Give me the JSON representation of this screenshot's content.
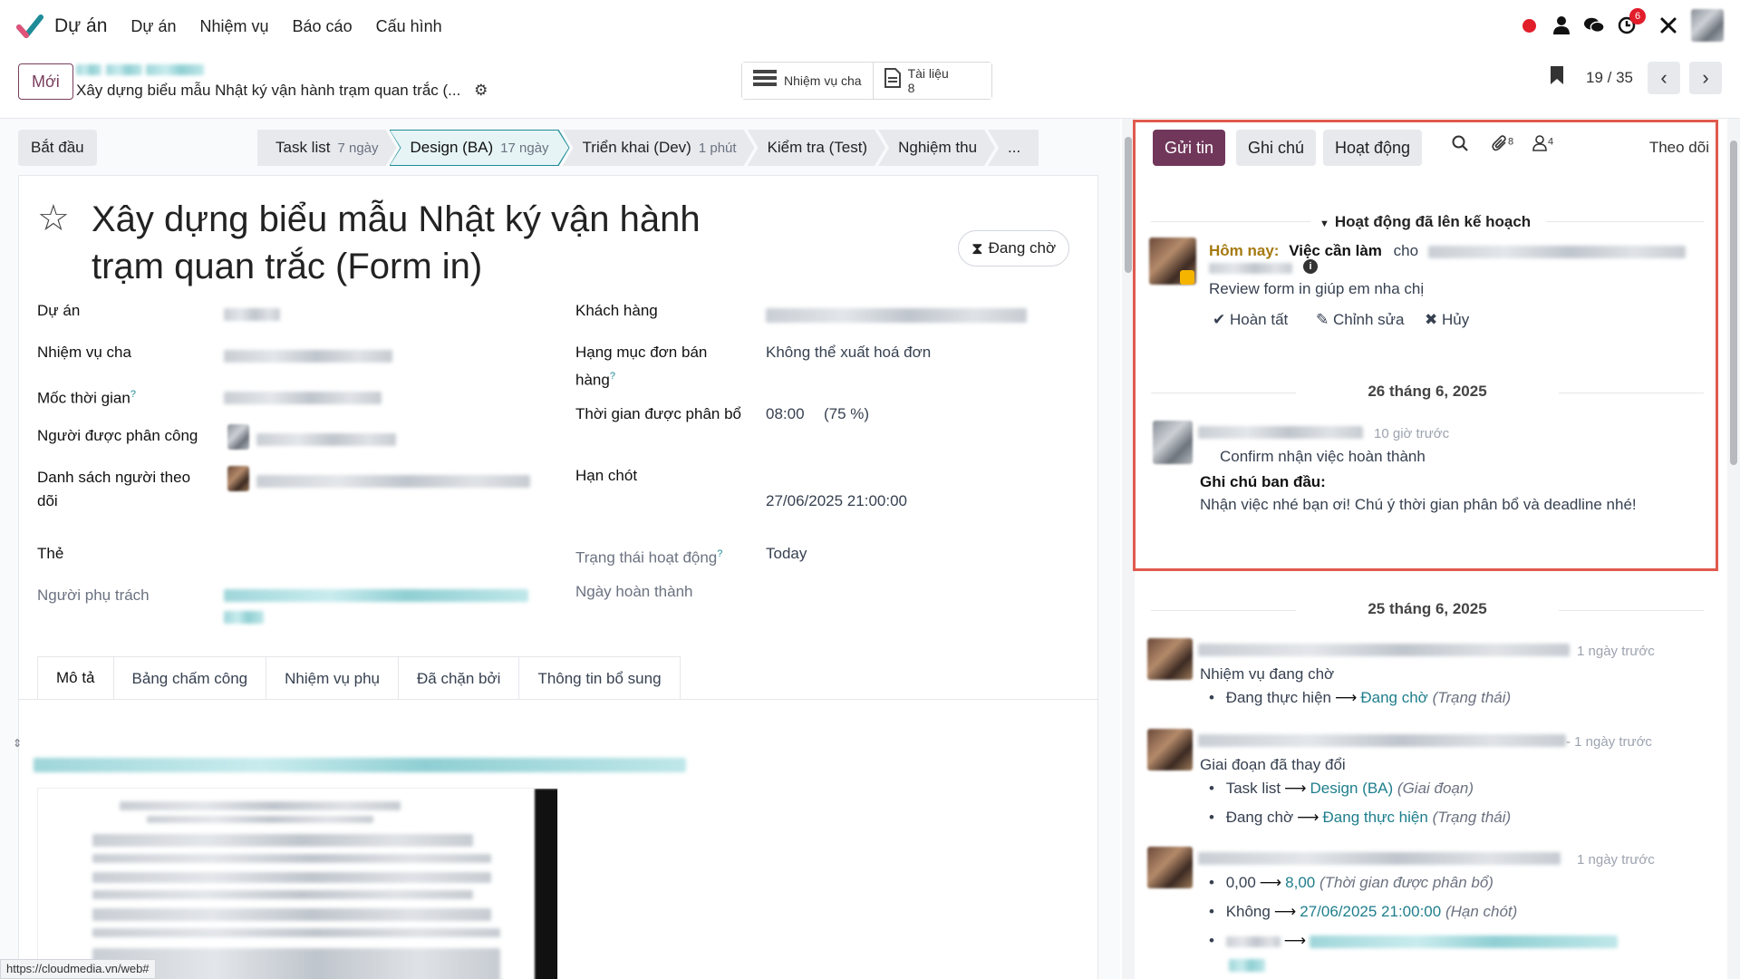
{
  "topnav": {
    "app_name": "Dự án",
    "menu": [
      "Dự án",
      "Nhiệm vụ",
      "Báo cáo",
      "Cấu hình"
    ],
    "activity_badge": "6",
    "colors": {
      "brand": "#71375b",
      "accent": "#1e8c98",
      "danger": "#e11d2a"
    }
  },
  "control": {
    "new_label": "Mới",
    "breadcrumb_title": "Xây dựng biểu mẫu Nhật ký vận hành trạm quan trắc (...",
    "smart_parent_label": "Nhiệm vụ cha",
    "smart_docs_label": "Tài liệu",
    "smart_docs_count": "8",
    "pager_value": "19 / 35"
  },
  "statusbar": {
    "start_label": "Bắt đầu",
    "stages": [
      {
        "label": "Task list",
        "sub": "7 ngày"
      },
      {
        "label": "Design (BA)",
        "sub": "17 ngày"
      },
      {
        "label": "Triển khai (Dev)",
        "sub": "1 phút"
      },
      {
        "label": "Kiểm tra (Test)",
        "sub": ""
      },
      {
        "label": "Nghiệm thu",
        "sub": ""
      },
      {
        "label": "...",
        "sub": ""
      }
    ]
  },
  "form": {
    "title": "Xây dựng biểu mẫu Nhật ký vận hành trạm quan trắc (Form in)",
    "status": "Đang chờ",
    "labels": {
      "project": "Dự án",
      "parent_task": "Nhiệm vụ cha",
      "milestone": "Mốc thời gian",
      "assignee": "Người được phân công",
      "followers": "Danh sách người theo dõi",
      "tags": "Thẻ",
      "responsible": "Người phụ trách",
      "customer": "Khách hàng",
      "sale_line": "Hạng mục đơn bán hàng",
      "allocated": "Thời gian được phân bổ",
      "deadline": "Hạn chót",
      "activity_state": "Trạng thái hoạt động",
      "done_date": "Ngày hoàn thành"
    },
    "values": {
      "sale_line": "Không thể xuất hoá đơn",
      "allocated_time": "08:00",
      "allocated_pct": "(75 %)",
      "deadline": "27/06/2025 21:00:00",
      "activity_state": "Today"
    },
    "tabs": [
      "Mô tả",
      "Bảng chấm công",
      "Nhiệm vụ phụ",
      "Đã chặn bởi",
      "Thông tin bổ sung"
    ]
  },
  "chatter": {
    "send_label": "Gửi tin",
    "note_label": "Ghi chú",
    "activity_label": "Hoạt động",
    "attachments_count": "8",
    "followers_count": "4",
    "follow_label": "Theo dõi",
    "planned_header": "Hoạt động đã lên kế hoạch",
    "planned": {
      "when": "Hôm nay:",
      "type": "Việc cần làm",
      "for": "cho",
      "summary": "Review form in giúp em nha chị",
      "done": "Hoàn tất",
      "edit": "Chỉnh sửa",
      "cancel": "Hủy"
    },
    "date1": "26 tháng 6, 2025",
    "msg1": {
      "time": "10 giờ trước",
      "body": "Confirm nhận việc hoàn thành",
      "orig_label": "Ghi chú ban đầu:",
      "orig_text": "Nhận việc nhé bạn ơi! Chú ý thời gian phân bổ và deadline nhé!"
    },
    "date2": "25 tháng 6, 2025",
    "msg2": {
      "time": "1 ngày trước",
      "title": "Nhiệm vụ đang chờ",
      "old": "Đang thực hiện",
      "new": "Đang chờ",
      "field": "(Trạng thái)"
    },
    "msg3": {
      "time": "- 1 ngày trước",
      "title": "Giai đoạn đã thay đổi",
      "c1_old": "Task list",
      "c1_new": "Design (BA)",
      "c1_field": "(Giai đoạn)",
      "c2_old": "Đang chờ",
      "c2_new": "Đang thực hiện",
      "c2_field": "(Trạng thái)"
    },
    "msg4": {
      "time": "1 ngày trước",
      "c1_old": "0,00",
      "c1_new": "8,00",
      "c1_field": "(Thời gian được phân bổ)",
      "c2_old": "Không",
      "c2_new": "27/06/2025 21:00:00",
      "c2_field": "(Hạn chót)"
    }
  },
  "status_url": "https://cloudmedia.vn/web#"
}
